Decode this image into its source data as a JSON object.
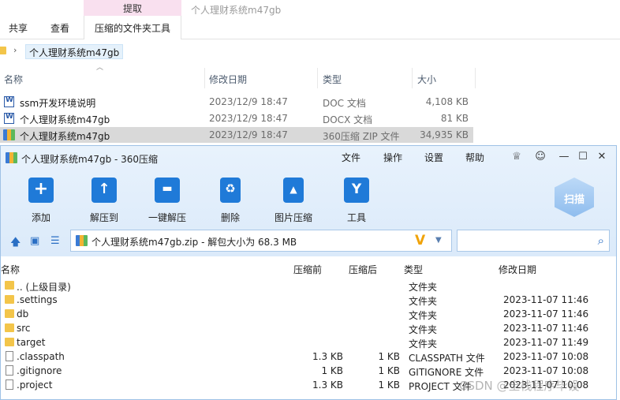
{
  "explorer": {
    "context_tab": "提取",
    "window_title": "个人理财系统m47gb",
    "tabs": [
      "共享",
      "查看"
    ],
    "active_tab": "压缩的文件夹工具",
    "breadcrumb": "个人理财系统m47gb",
    "columns": {
      "name": "名称",
      "date": "修改日期",
      "type": "类型",
      "size": "大小"
    },
    "files": [
      {
        "name": "ssm开发环境说明",
        "date": "2023/12/9 18:47",
        "type": "DOC 文档",
        "size": "4,108 KB",
        "icon": "word-doc-icon"
      },
      {
        "name": "个人理财系统m47gb",
        "date": "2023/12/9 18:47",
        "type": "DOCX 文档",
        "size": "81 KB",
        "icon": "word-doc-icon"
      },
      {
        "name": "个人理财系统m47gb",
        "date": "2023/12/9 18:47",
        "type": "360压缩 ZIP 文件",
        "size": "34,935 KB",
        "icon": "zip-archive-icon"
      }
    ]
  },
  "zip_window": {
    "title": "个人理财系统m47gb - 360压缩",
    "menu": [
      "文件",
      "操作",
      "设置",
      "帮助"
    ],
    "toolbar": [
      {
        "label": "添加",
        "icon": "add-icon"
      },
      {
        "label": "解压到",
        "icon": "extract-to-icon"
      },
      {
        "label": "一键解压",
        "icon": "one-click-extract-icon"
      },
      {
        "label": "删除",
        "icon": "delete-icon"
      },
      {
        "label": "图片压缩",
        "icon": "image-compress-icon"
      },
      {
        "label": "工具",
        "icon": "tools-icon"
      }
    ],
    "scan_label": "扫描",
    "path": "个人理财系统m47gb.zip - 解包大小为 68.3 MB",
    "columns": {
      "name": "名称",
      "size": "压缩前",
      "compressed": "压缩后",
      "type": "类型",
      "date": "修改日期"
    },
    "entries": [
      {
        "name": ".. (上级目录)",
        "size": "",
        "compressed": "",
        "type": "文件夹",
        "date": "",
        "icon": "folder-icon"
      },
      {
        "name": ".settings",
        "size": "",
        "compressed": "",
        "type": "文件夹",
        "date": "2023-11-07 11:46",
        "icon": "folder-icon"
      },
      {
        "name": "db",
        "size": "",
        "compressed": "",
        "type": "文件夹",
        "date": "2023-11-07 11:46",
        "icon": "folder-icon"
      },
      {
        "name": "src",
        "size": "",
        "compressed": "",
        "type": "文件夹",
        "date": "2023-11-07 11:46",
        "icon": "folder-icon"
      },
      {
        "name": "target",
        "size": "",
        "compressed": "",
        "type": "文件夹",
        "date": "2023-11-07 11:49",
        "icon": "folder-icon"
      },
      {
        "name": ".classpath",
        "size": "1.3 KB",
        "compressed": "1 KB",
        "type": "CLASSPATH 文件",
        "date": "2023-11-07 10:08",
        "icon": "file-icon"
      },
      {
        "name": ".gitignore",
        "size": "1 KB",
        "compressed": "1 KB",
        "type": "GITIGNORE 文件",
        "date": "2023-11-07 10:08",
        "icon": "file-icon"
      },
      {
        "name": ".project",
        "size": "1.3 KB",
        "compressed": "1 KB",
        "type": "PROJECT 文件",
        "date": "2023-11-07 10:08",
        "icon": "file-icon"
      }
    ]
  },
  "watermark": "CSDN @全栈程序毕设",
  "colors": {
    "accent": "#1f7ad8",
    "context_band": "#f9e0ef",
    "zip_header": "#e8f2fc",
    "folder": "#f3c54a"
  }
}
